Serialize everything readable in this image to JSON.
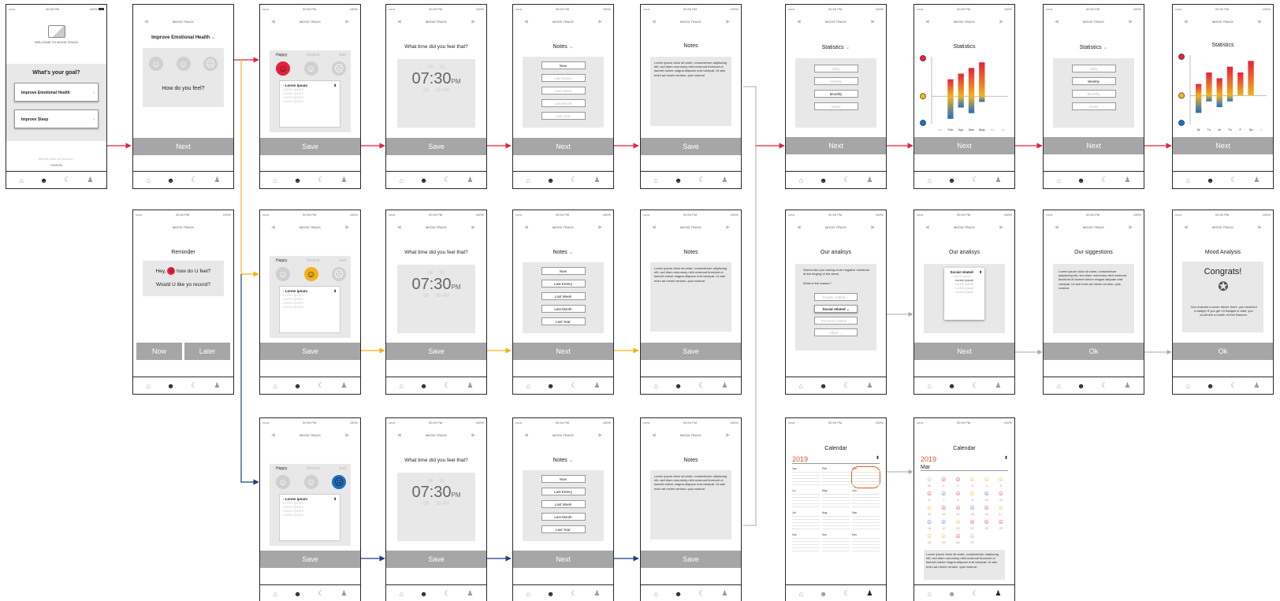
{
  "status": {
    "time": "00:00 PM",
    "battery": "100%"
  },
  "common": {
    "app_title": "MOOD TRACK",
    "next": "Next",
    "save": "Save",
    "ok": "Ok",
    "notes": "Notes",
    "statistics": "Statistics",
    "question_time": "What time did you feel that?",
    "moods": [
      "Happy",
      "Neutral",
      "Sad"
    ],
    "picker_selected": "- Lorem ipsum",
    "picker_option": "Lorem ipsum",
    "time_prev": [
      "08",
      "31"
    ],
    "time_next": [
      "06",
      "29",
      "AM"
    ],
    "time_far_prev": "30",
    "time_far_next": "30",
    "time_hhmm": "07:30",
    "time_ampm": "PM",
    "notes_menu": [
      "New",
      "Last Entery",
      "Last Week",
      "Last Month",
      "Last Year"
    ],
    "stats_menu": [
      "Daily",
      "Weekly",
      "Monthly",
      "Yearly"
    ],
    "lorem": "Lorem ipsum dolor sit amet, consectetuer adipiscing elit, sed diam nonummy nibh euismod tincidunt ut laoreet dolore magna aliquam erat volutpat. Ut wisi enim ad minim veniam, quis nostrud",
    "nav_icons": [
      "home-icon",
      "smiley-icon",
      "moon-icon",
      "user-icon"
    ]
  },
  "welcome": {
    "caption": "WELCOME TO MOOD TRACK",
    "question": "What's your goal?",
    "goals": [
      "Improve Emotional Health",
      "Improve Sleep"
    ],
    "account_text": "Already have an account?",
    "sign_in": "SIGN IN"
  },
  "feel": {
    "goal": "Improve Emotional Health",
    "question": "How do you feel?"
  },
  "reminder": {
    "title": "Reminder",
    "greeting_pre": "Hey,",
    "greeting_post": "how do U feel?",
    "line2": "Would U like yo record?",
    "now": "Now",
    "later": "Later"
  },
  "analysis": {
    "title": "Our analisys",
    "text": "Seems like you having more negative emotions at the beging of the week.",
    "reason_q": "What is the reason?",
    "reasons": [
      "People related",
      "Social related",
      "Personal related",
      "Other"
    ],
    "selected": "Social related"
  },
  "suggestions": {
    "title": "Our siggestions"
  },
  "mood_analysis": {
    "title": "Mood Analysis",
    "congrats": "Congrats!",
    "text": "You recieved a score above three, you received a badge! If you get 10 badges in total, you could win a month of free lessons."
  },
  "calendar": {
    "title": "Calendar",
    "year": "2019",
    "months": [
      "Jan",
      "Feb",
      "Mar",
      "Apr",
      "May",
      "Jun",
      "Jul",
      "Aug",
      "Sep",
      "Oct",
      "Nov",
      "Dec"
    ],
    "month_open": "Mar",
    "days": [
      "31",
      "1",
      "2",
      "3",
      "4",
      "5",
      "6",
      "7",
      "8",
      "9",
      "10",
      "11",
      "12",
      "13",
      "14",
      "15",
      "16",
      "17",
      "18",
      "19",
      "20",
      "21",
      "22",
      "23",
      "24",
      "25",
      "26",
      "27"
    ]
  },
  "chart_data": [
    {
      "type": "bar",
      "title": "Statistics",
      "xlabel": "",
      "ylabel": "",
      "categories": [
        "Jan",
        "Feb",
        "Apr",
        "Mar",
        "May",
        "Jun",
        "Jul"
      ],
      "series": [
        {
          "values": [
            0,
            3,
            4,
            5,
            6,
            0,
            0
          ]
        },
        {
          "values": [
            0,
            -4,
            -2,
            -3,
            -1,
            0,
            0
          ]
        }
      ],
      "ylim": [
        -5,
        7
      ],
      "colors": [
        "#e8203a",
        "#1e6fc4"
      ]
    },
    {
      "type": "bar",
      "title": "Statistics",
      "xlabel": "",
      "ylabel": "",
      "categories": [
        "M",
        "Tu",
        "W",
        "Th",
        "F",
        "Sa",
        "S"
      ],
      "series": [
        {
          "values": [
            2,
            4,
            3,
            5,
            4,
            6,
            0
          ]
        },
        {
          "values": [
            -3,
            -1,
            -2,
            -1,
            0,
            0,
            0
          ]
        }
      ],
      "ylim": [
        -5,
        7
      ],
      "colors": [
        "#e8203a",
        "#1e6fc4"
      ]
    }
  ],
  "colors": {
    "accent": "#e8203a",
    "yellow": "#f3b21b",
    "blue": "#1e6fc4",
    "orange": "#e05a1b",
    "bar": "#a6a6a8"
  }
}
